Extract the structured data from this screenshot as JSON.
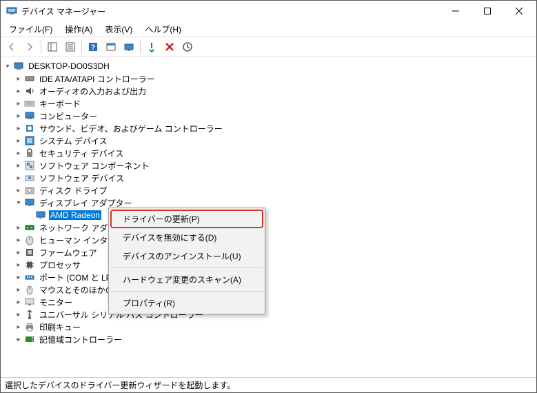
{
  "window": {
    "title": "デバイス マネージャー"
  },
  "menu": {
    "file": "ファイル(F)",
    "action": "操作(A)",
    "view": "表示(V)",
    "help": "ヘルプ(H)"
  },
  "tree": {
    "root": "DESKTOP-DO0S3DH",
    "items": [
      {
        "label": "IDE ATA/ATAPI コントローラー",
        "icon": "ide"
      },
      {
        "label": "オーディオの入力および出力",
        "icon": "audio"
      },
      {
        "label": "キーボード",
        "icon": "keyboard"
      },
      {
        "label": "コンピューター",
        "icon": "computer"
      },
      {
        "label": "サウンド、ビデオ、およびゲーム コントローラー",
        "icon": "sound"
      },
      {
        "label": "システム デバイス",
        "icon": "system"
      },
      {
        "label": "セキュリティ デバイス",
        "icon": "security"
      },
      {
        "label": "ソフトウェア コンポーネント",
        "icon": "swcomp"
      },
      {
        "label": "ソフトウェア デバイス",
        "icon": "swdev"
      },
      {
        "label": "ディスク ドライブ",
        "icon": "disk"
      },
      {
        "label": "ディスプレイ アダプター",
        "icon": "display",
        "expanded": true,
        "children": [
          {
            "label": "AMD Radeon",
            "icon": "display",
            "selected": true
          }
        ]
      },
      {
        "label": "ネットワーク アダプタ",
        "icon": "network"
      },
      {
        "label": "ヒューマン インターフ",
        "icon": "hid"
      },
      {
        "label": "ファームウェア",
        "icon": "firmware"
      },
      {
        "label": "プロセッサ",
        "icon": "cpu"
      },
      {
        "label": "ポート (COM と LP",
        "icon": "port"
      },
      {
        "label": "マウスとそのほかの",
        "icon": "mouse"
      },
      {
        "label": "モニター",
        "icon": "monitor"
      },
      {
        "label": "ユニバーサル シリアル バス コントローラー",
        "icon": "usb"
      },
      {
        "label": "印刷キュー",
        "icon": "printer"
      },
      {
        "label": "記憶域コントローラー",
        "icon": "storage"
      }
    ]
  },
  "context_menu": {
    "update": "ドライバーの更新(P)",
    "disable": "デバイスを無効にする(D)",
    "uninstall": "デバイスのアンインストール(U)",
    "scan": "ハードウェア変更のスキャン(A)",
    "properties": "プロパティ(R)"
  },
  "status": "選択したデバイスのドライバー更新ウィザードを起動します。"
}
